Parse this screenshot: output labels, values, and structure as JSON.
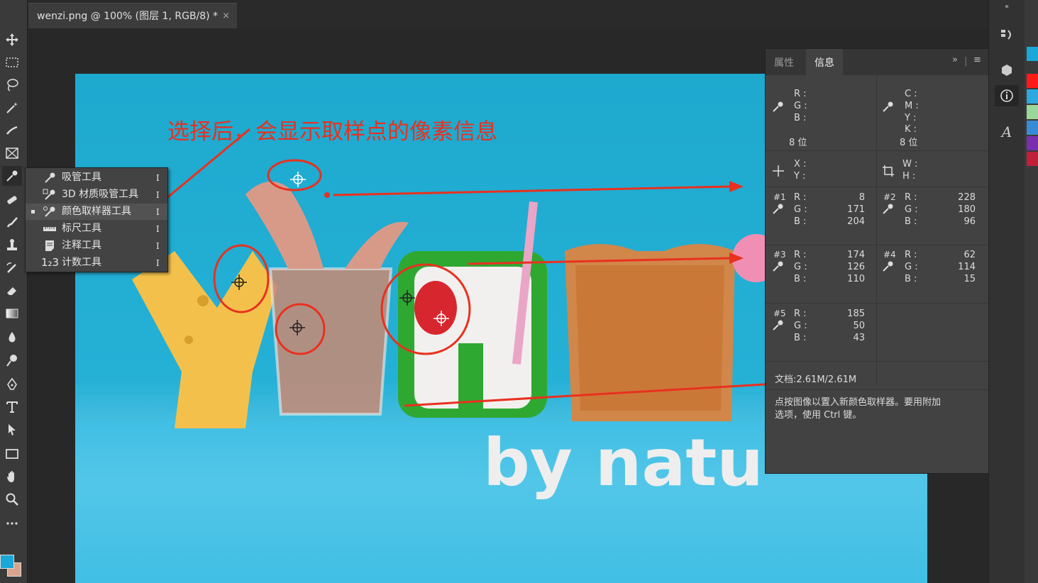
{
  "document_tab": {
    "title": "wenzi.png @ 100% (图层 1, RGB/8) *",
    "close": "×"
  },
  "flyout": {
    "items": [
      {
        "label": "吸管工具",
        "key": "I",
        "selected": false,
        "icon": "eyedropper-icon"
      },
      {
        "label": "3D 材质吸管工具",
        "key": "I",
        "selected": false,
        "icon": "3d-material-eyedropper-icon"
      },
      {
        "label": "颜色取样器工具",
        "key": "I",
        "selected": true,
        "icon": "color-sampler-icon"
      },
      {
        "label": "标尺工具",
        "key": "I",
        "selected": false,
        "icon": "ruler-icon"
      },
      {
        "label": "注释工具",
        "key": "I",
        "selected": false,
        "icon": "note-icon"
      },
      {
        "label": "计数工具",
        "key": "I",
        "selected": false,
        "icon": "count-icon",
        "prefix": "1₂3"
      }
    ]
  },
  "annotation": {
    "text": "选择后，会显示取样点的像素信息",
    "color": "#e8311f"
  },
  "image": {
    "bottom_text": "by natu"
  },
  "panel": {
    "tabs": [
      "属性",
      "信息"
    ],
    "active_tab": "信息",
    "expand": "»",
    "rgb_block": {
      "r": "R :",
      "g": "G :",
      "b": "B :",
      "bits": "8 位"
    },
    "cmyk_block": {
      "c": "C :",
      "m": "M :",
      "y": "Y :",
      "k": "K :",
      "bits": "8 位"
    },
    "xy": {
      "x": "X :",
      "y": "Y :"
    },
    "wh": {
      "w": "W :",
      "h": "H :"
    },
    "samplers": [
      {
        "id": "#1",
        "r": "8",
        "g": "171",
        "b": "204"
      },
      {
        "id": "#2",
        "r": "228",
        "g": "180",
        "b": "96"
      },
      {
        "id": "#3",
        "r": "174",
        "g": "126",
        "b": "110"
      },
      {
        "id": "#4",
        "r": "62",
        "g": "114",
        "b": "15"
      },
      {
        "id": "#5",
        "r": "185",
        "g": "50",
        "b": "43"
      }
    ],
    "labels": {
      "r": "R :",
      "g": "G :",
      "b": "B :"
    },
    "doc_size": "文档:2.61M/2.61M",
    "hint": "点按图像以置入新颜色取样器。要用附加\n选项，使用 Ctrl 键。"
  },
  "swatches": [
    "#1aa8d8",
    "#ff1a1a",
    "#2ea8e0",
    "#9ad79a",
    "#3a8bd6",
    "#7a2fb0",
    "#c0203a"
  ]
}
